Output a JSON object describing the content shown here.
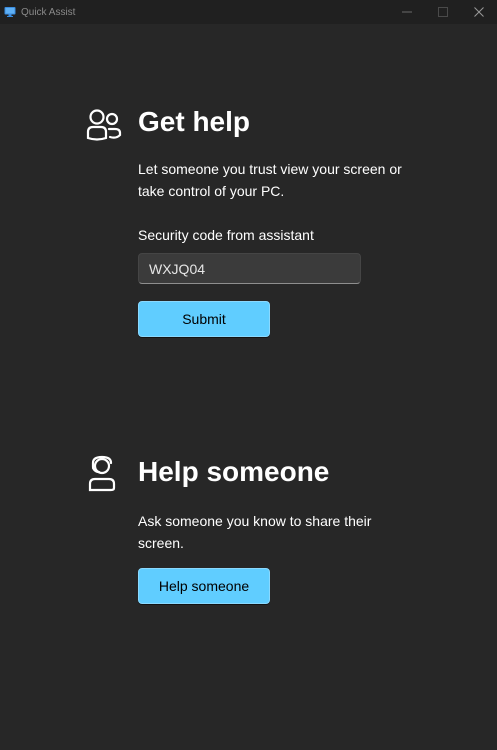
{
  "window": {
    "title": "Quick Assist",
    "controls": {
      "minimize_icon": "minimize-icon",
      "maximize_icon": "maximize-icon",
      "close_icon": "close-icon"
    }
  },
  "colors": {
    "background": "#272727",
    "titlebar": "#202020",
    "accent": "#60cdff",
    "text": "#ffffff"
  },
  "get_help": {
    "icon": "people-icon",
    "title": "Get help",
    "description": "Let someone you trust view your screen or take control of your PC.",
    "code_label": "Security code from assistant",
    "code_value": "WXJQ04",
    "submit_label": "Submit"
  },
  "help_someone": {
    "icon": "person-headset-icon",
    "title": "Help someone",
    "description": "Ask someone you know to share their screen.",
    "button_label": "Help someone"
  }
}
